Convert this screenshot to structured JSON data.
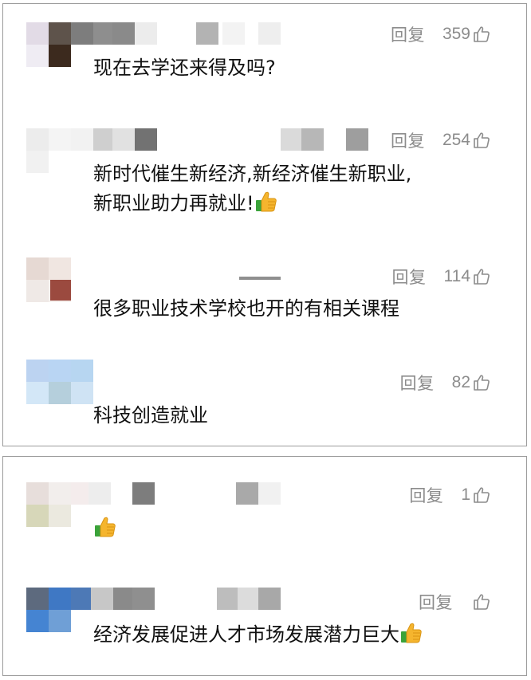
{
  "comments_top": [
    {
      "reply_label": "回复",
      "likes": "359",
      "text": "现在去学还来得及吗?"
    },
    {
      "reply_label": "回复",
      "likes": "254",
      "text_line1": "新时代催生新经济,新经济催生新职业,",
      "text_line2": "新职业助力再就业!",
      "emoji": "thumbs-up"
    },
    {
      "reply_label": "回复",
      "likes": "114",
      "text": "很多职业技术学校也开的有相关课程"
    },
    {
      "reply_label": "回复",
      "likes": "82",
      "text": "科技创造就业"
    }
  ],
  "comments_bottom": [
    {
      "reply_label": "回复",
      "likes": "1",
      "text": "",
      "emoji": "thumbs-up"
    },
    {
      "reply_label": "回复",
      "likes": "",
      "text": "经济发展促进人才市场发展潜力巨大",
      "emoji": "thumbs-up"
    }
  ],
  "colors": {
    "muted": "#8c8c8c",
    "text": "#111111",
    "border": "#9b9b9b",
    "emoji_yellow": "#f5b52e",
    "emoji_cuff": "#3aa33a"
  }
}
